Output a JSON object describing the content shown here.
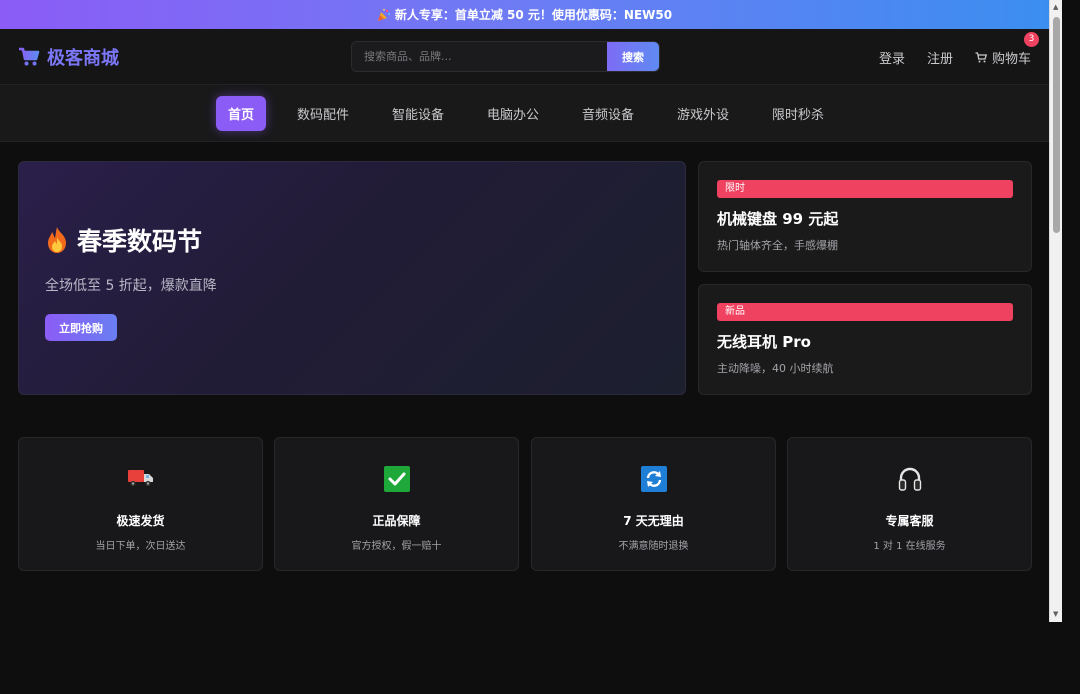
{
  "promo": {
    "icon": "party-popper-icon",
    "text": "新人专享：首单立减 50 元！使用优惠码：NEW50"
  },
  "header": {
    "logo_text": "极客商城",
    "search_placeholder": "搜索商品、品牌...",
    "search_button": "搜索",
    "login": "登录",
    "register": "注册",
    "cart_label": "购物车",
    "cart_count": "3"
  },
  "nav": {
    "items": [
      {
        "label": "首页",
        "active": true
      },
      {
        "label": "数码配件"
      },
      {
        "label": "智能设备"
      },
      {
        "label": "电脑办公"
      },
      {
        "label": "音频设备"
      },
      {
        "label": "游戏外设"
      },
      {
        "label": "限时秒杀"
      }
    ]
  },
  "hero": {
    "title": "春季数码节",
    "subtitle": "全场低至 5 折起，爆款直降",
    "button": "立即抢购"
  },
  "side_cards": [
    {
      "tag": "限时",
      "title": "机械键盘 99 元起",
      "desc": "热门轴体齐全，手感爆棚"
    },
    {
      "tag": "新品",
      "title": "无线耳机 Pro",
      "desc": "主动降噪，40 小时续航"
    }
  ],
  "features": [
    {
      "icon": "truck-icon",
      "title": "极速发货",
      "desc": "当日下单，次日送达"
    },
    {
      "icon": "checkmark-icon",
      "title": "正品保障",
      "desc": "官方授权，假一赔十"
    },
    {
      "icon": "refresh-icon",
      "title": "7 天无理由",
      "desc": "不满意随时退换"
    },
    {
      "icon": "headphones-icon",
      "title": "专属客服",
      "desc": "1 对 1 在线服务"
    }
  ],
  "colors": {
    "accent": "#8b5cf6",
    "accent_blue": "#3b8ef0",
    "tag_red": "#ef4260",
    "background": "#0e0e0f"
  }
}
